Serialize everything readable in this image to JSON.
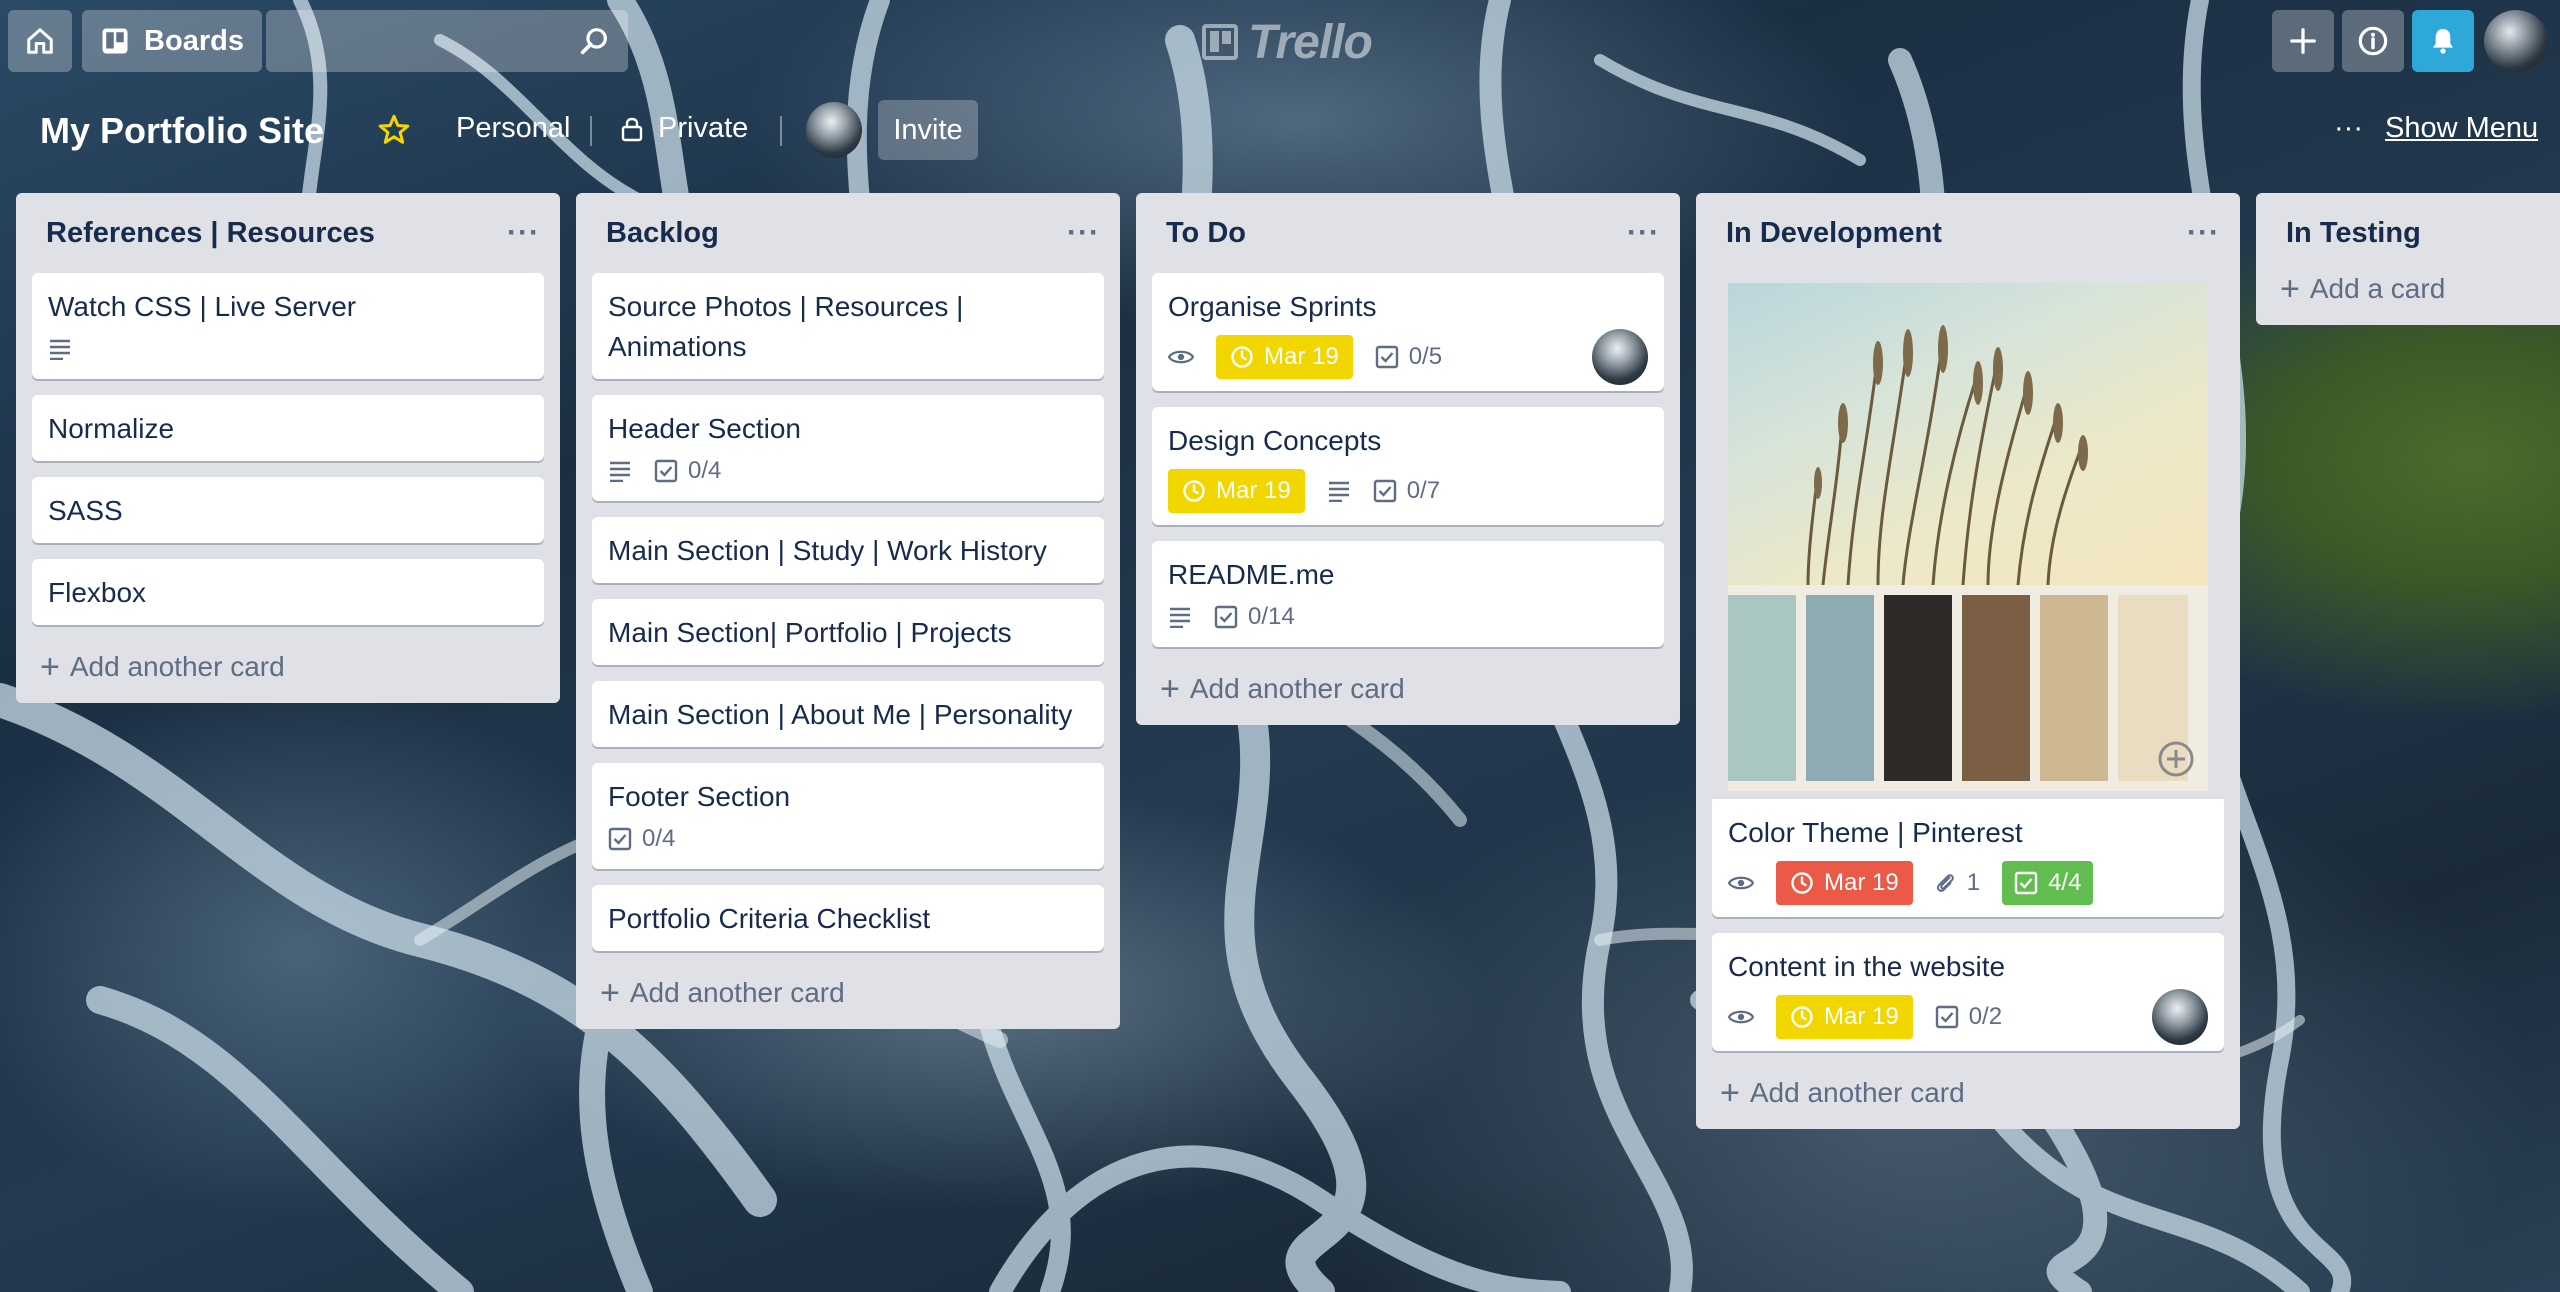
{
  "topbar": {
    "boards_label": "Boards",
    "search_placeholder": "",
    "logo_text": "Trello"
  },
  "board": {
    "title": "My Portfolio Site",
    "team": "Personal",
    "visibility": "Private",
    "invite_label": "Invite",
    "show_menu_label": "Show Menu",
    "more_label": "···"
  },
  "colors": {
    "due_yellow": "#f2d600",
    "due_red": "#eb5a46",
    "checklist_done": "#61bd4f",
    "notification_blue": "#2ea8d8",
    "list_bg": "#dfe1e6",
    "star": "#f2d600"
  },
  "lists": [
    {
      "title": "References | Resources",
      "add_label": "Add another card",
      "cards": [
        {
          "title": "Watch CSS | Live Server",
          "description": true
        },
        {
          "title": "Normalize"
        },
        {
          "title": "SASS"
        },
        {
          "title": "Flexbox"
        }
      ]
    },
    {
      "title": "Backlog",
      "add_label": "Add another card",
      "cards": [
        {
          "title": "Source Photos | Resources | Animations"
        },
        {
          "title": "Header Section",
          "description": true,
          "checklist": "0/4"
        },
        {
          "title": "Main Section | Study | Work History"
        },
        {
          "title": "Main Section| Portfolio | Projects"
        },
        {
          "title": "Main Section | About Me | Personality"
        },
        {
          "title": "Footer Section",
          "checklist": "0/4"
        },
        {
          "title": "Portfolio Criteria Checklist"
        }
      ]
    },
    {
      "title": "To Do",
      "add_label": "Add another card",
      "cards": [
        {
          "title": "Organise Sprints",
          "watching": true,
          "due": "Mar 19",
          "checklist": "0/5",
          "member": true
        },
        {
          "title": "Design Concepts",
          "due": "Mar 19",
          "description": true,
          "checklist": "0/7"
        },
        {
          "title": "README.me",
          "description": true,
          "checklist": "0/14"
        }
      ]
    },
    {
      "title": "In Development",
      "add_label": "Add another card",
      "cards": [
        {
          "title": "Color Theme | Pinterest",
          "cover": true,
          "watching": true,
          "due": "Mar 19",
          "due_status": "overdue",
          "attachments": "1",
          "checklist": "4/4"
        },
        {
          "title": "Content in the website",
          "watching": true,
          "due": "Mar 19",
          "checklist": "0/2",
          "member": true
        }
      ],
      "palette": [
        "#a9c6c0",
        "#8eaab3",
        "#2d2a27",
        "#7b5f45",
        "#cdb891",
        "#eadcc0"
      ]
    },
    {
      "title": "In Testing",
      "add_label": "Add a card",
      "cards": []
    }
  ],
  "icons": [
    "home-icon",
    "boards-icon",
    "search-icon",
    "plus-icon",
    "info-icon",
    "bell-icon",
    "star-icon",
    "lock-icon",
    "eye-icon",
    "clock-icon",
    "checklist-icon",
    "description-icon",
    "paperclip-icon",
    "more-icon"
  ]
}
